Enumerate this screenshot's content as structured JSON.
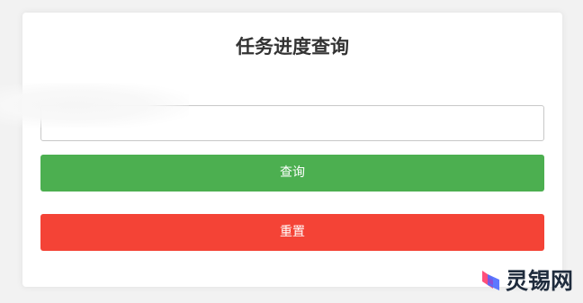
{
  "page": {
    "title": "任务进度查询"
  },
  "form": {
    "input_value": "",
    "input_placeholder": "",
    "query_label": "查询",
    "reset_label": "重置"
  },
  "colors": {
    "query_button": "#4caf50",
    "reset_button": "#f44336",
    "title_text": "#333333",
    "background": "#f2f2f2"
  },
  "watermark": {
    "text": "灵锡网",
    "icon": "lingxi-logo-icon"
  }
}
